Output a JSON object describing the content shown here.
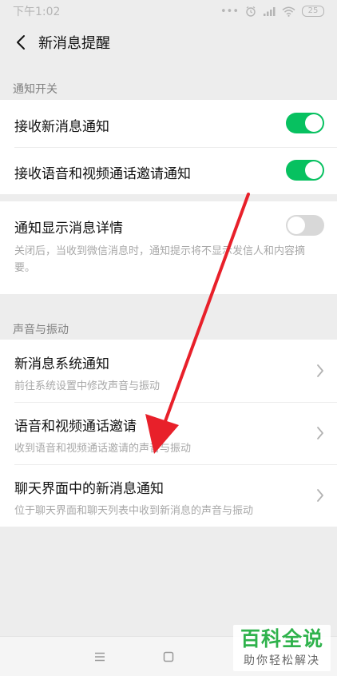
{
  "status_bar": {
    "time": "下午1:02",
    "battery": "25"
  },
  "header": {
    "title": "新消息提醒"
  },
  "sections": {
    "notify_switch_label": "通知开关",
    "sound_vibration_label": "声音与振动"
  },
  "notify_rows": {
    "receive_new_msg": {
      "label": "接收新消息通知",
      "toggle": "on"
    },
    "receive_call_invite": {
      "label": "接收语音和视频通话邀请通知",
      "toggle": "on"
    }
  },
  "detail_row": {
    "label": "通知显示消息详情",
    "toggle": "off",
    "description": "关闭后，当收到微信消息时，通知提示将不显示发信人和内容摘要。"
  },
  "sound_rows": [
    {
      "title": "新消息系统通知",
      "subtitle": "前往系统设置中修改声音与振动"
    },
    {
      "title": "语音和视频通话邀请",
      "subtitle": "收到语音和视频通话邀请的声音与振动"
    },
    {
      "title": "聊天界面中的新消息通知",
      "subtitle": "位于聊天界面和聊天列表中收到新消息的声音与振动"
    }
  ],
  "watermark": {
    "main": "百科全说",
    "sub": "助你轻松解决"
  },
  "colors": {
    "toggle_on": "#07c160",
    "toggle_off": "#d8d8d8",
    "annotation_arrow": "#e8202a",
    "watermark_green": "#2fb24c"
  }
}
